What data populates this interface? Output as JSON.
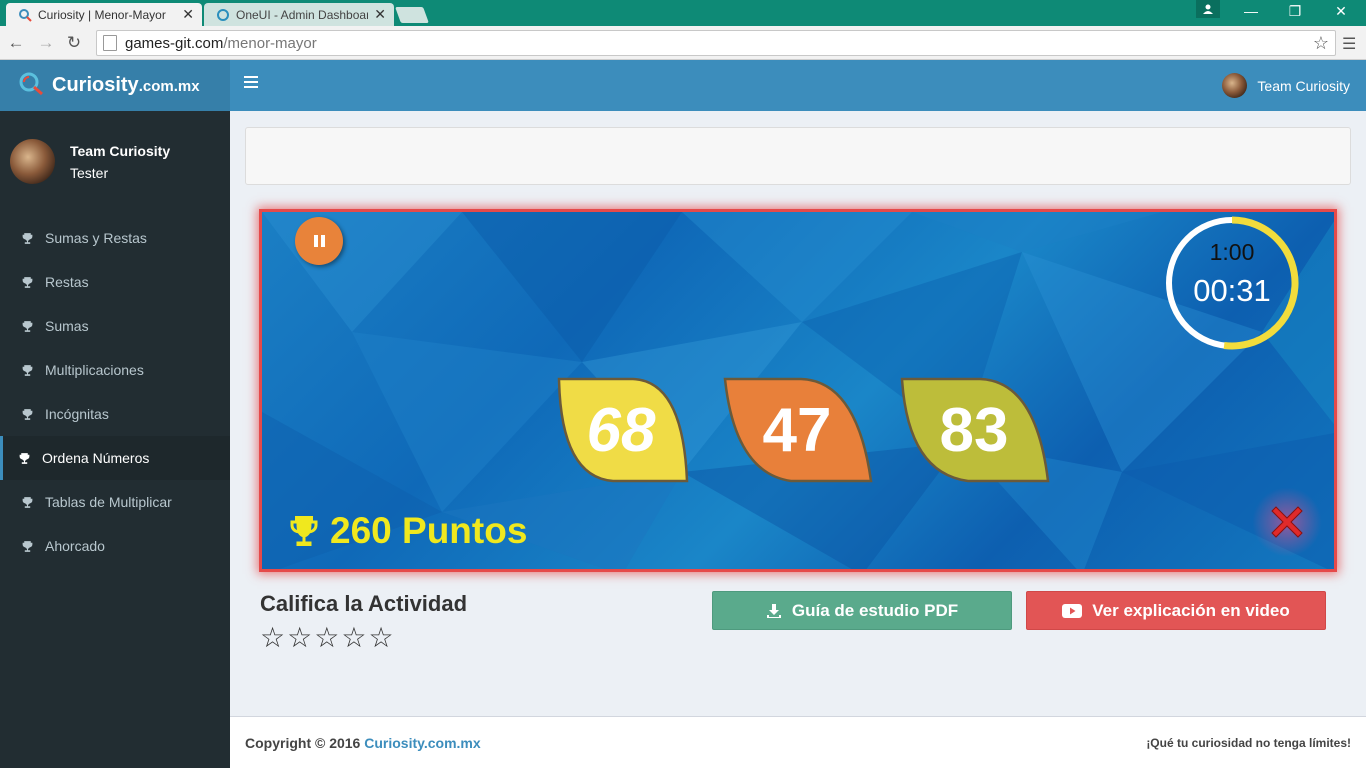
{
  "browser": {
    "tabs": [
      {
        "title": "Curiosity | Menor-Mayor",
        "active": true
      },
      {
        "title": "OneUI - Admin Dashboard",
        "active": false
      }
    ],
    "url_host": "games-git.com",
    "url_path": "/menor-mayor"
  },
  "header": {
    "brand_main": "Curiosity",
    "brand_suffix": ".com.mx",
    "user_name": "Team Curiosity"
  },
  "sidebar": {
    "user_name": "Team Curiosity",
    "user_role": "Tester",
    "items": [
      {
        "label": "Sumas y Restas",
        "active": false
      },
      {
        "label": "Restas",
        "active": false
      },
      {
        "label": "Sumas",
        "active": false
      },
      {
        "label": "Multiplicaciones",
        "active": false
      },
      {
        "label": "Incógnitas",
        "active": false
      },
      {
        "label": "Ordena Números",
        "active": true
      },
      {
        "label": "Tablas de Multiplicar",
        "active": false
      },
      {
        "label": "Ahorcado",
        "active": false
      }
    ]
  },
  "game": {
    "timer_total": "1:00",
    "timer_remaining": "00:31",
    "timer_progress_fraction": 0.52,
    "numbers": [
      {
        "value": "68",
        "color": "#f0dc46"
      },
      {
        "value": "47",
        "color": "#e8803a"
      },
      {
        "value": "83",
        "color": "#bdbd3a"
      }
    ],
    "score_text": "260 Puntos",
    "colors": {
      "pause": "#e8833a",
      "score": "#f0e81e",
      "close": "#e02a2a",
      "frame": "#e54a4a"
    }
  },
  "rating": {
    "title": "Califica la Actividad",
    "stars": 5
  },
  "actions": {
    "guide_label": "Guía de estudio PDF",
    "video_label": "Ver explicación en video"
  },
  "footer": {
    "copyright": "Copyright © 2016",
    "site": "Curiosity.com.mx",
    "slogan": "¡Qué tu curiosidad no tenga límites!"
  }
}
